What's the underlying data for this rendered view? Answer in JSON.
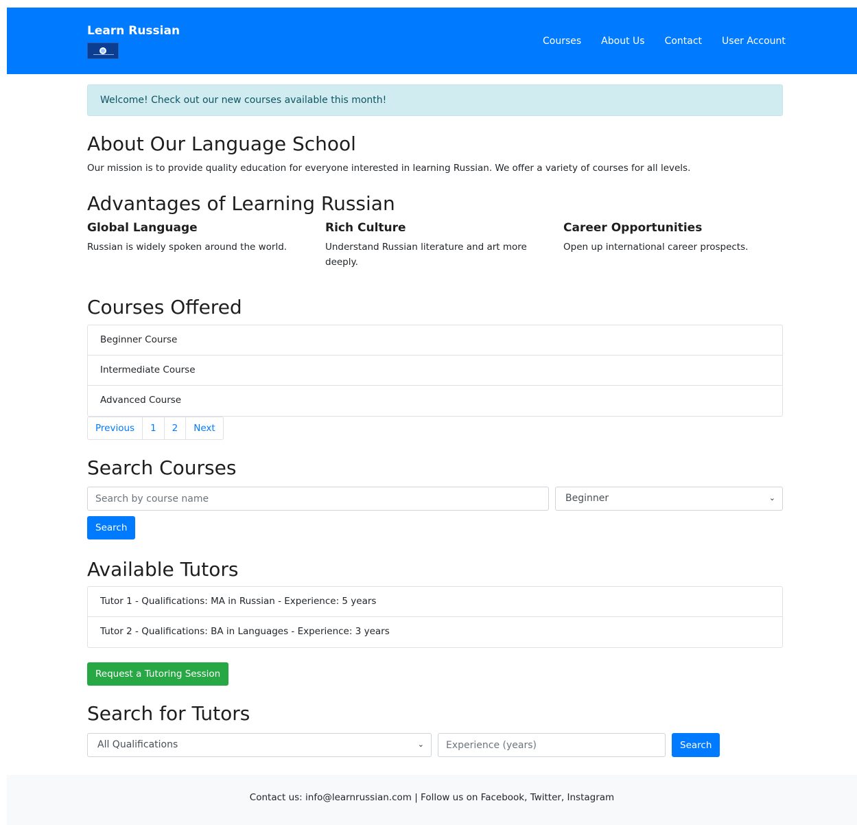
{
  "navbar": {
    "brand": "Learn Russian",
    "links": [
      "Courses",
      "About Us",
      "Contact",
      "User Account"
    ]
  },
  "alert": {
    "text": "Welcome! Check out our new courses available this month!"
  },
  "about": {
    "title": "About Our Language School",
    "text": "Our mission is to provide quality education for everyone interested in learning Russian. We offer a variety of courses for all levels."
  },
  "advantages": {
    "title": "Advantages of Learning Russian",
    "items": [
      {
        "title": "Global Language",
        "text": "Russian is widely spoken around the world."
      },
      {
        "title": "Rich Culture",
        "text": "Understand Russian literature and art more deeply."
      },
      {
        "title": "Career Opportunities",
        "text": "Open up international career prospects."
      }
    ]
  },
  "courses": {
    "title": "Courses Offered",
    "items": [
      "Beginner Course",
      "Intermediate Course",
      "Advanced Course"
    ],
    "pagination": [
      "Previous",
      "1",
      "2",
      "Next"
    ]
  },
  "search_courses": {
    "title": "Search Courses",
    "placeholder": "Search by course name",
    "level_selected": "Beginner",
    "button": "Search"
  },
  "tutors": {
    "title": "Available Tutors",
    "items": [
      "Tutor 1 - Qualifications: MA in Russian - Experience: 5 years",
      "Tutor 2 - Qualifications: BA in Languages - Experience: 3 years"
    ],
    "request_button": "Request a Tutoring Session"
  },
  "search_tutors": {
    "title": "Search for Tutors",
    "qualification_selected": "All Qualifications",
    "experience_placeholder": "Experience (years)",
    "button": "Search"
  },
  "footer": {
    "text": "Contact us: info@learnrussian.com | Follow us on Facebook, Twitter, Instagram"
  }
}
